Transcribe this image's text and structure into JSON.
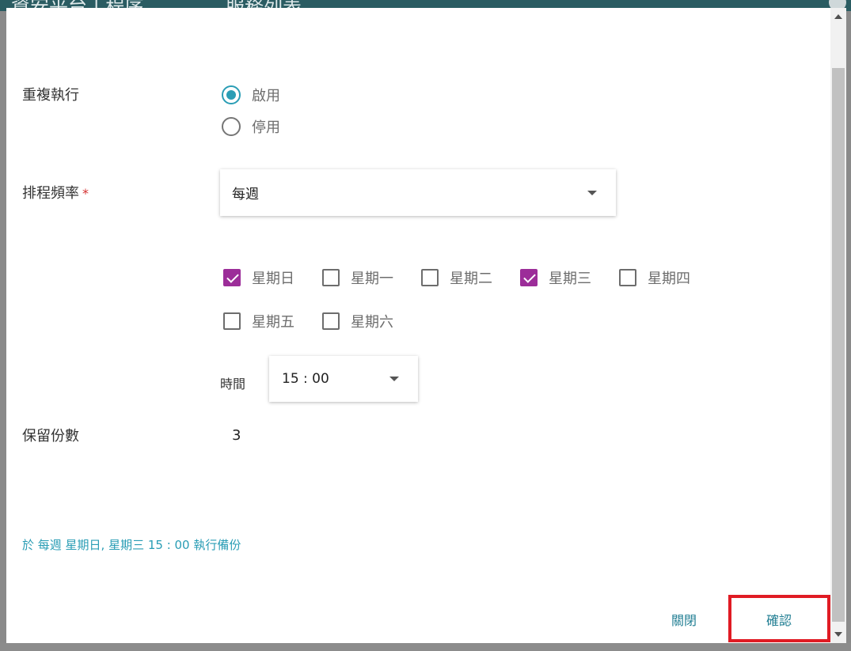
{
  "background": {
    "header_left": "資安平台 | 程序",
    "header_right": "服務列表"
  },
  "dialog": {
    "repeat": {
      "label": "重複執行",
      "options": [
        {
          "label": "啟用",
          "checked": true
        },
        {
          "label": "停用",
          "checked": false
        }
      ]
    },
    "frequency": {
      "label": "排程頻率",
      "required_mark": "*",
      "value": "每週"
    },
    "weekdays": [
      {
        "label": "星期日",
        "checked": true
      },
      {
        "label": "星期一",
        "checked": false
      },
      {
        "label": "星期二",
        "checked": false
      },
      {
        "label": "星期三",
        "checked": true
      },
      {
        "label": "星期四",
        "checked": false
      },
      {
        "label": "星期五",
        "checked": false
      },
      {
        "label": "星期六",
        "checked": false
      }
    ],
    "time": {
      "label": "時間",
      "value": "15 : 00"
    },
    "retain": {
      "label": "保留份數",
      "value": "3"
    },
    "summary": "於 每週 星期日, 星期三 15 : 00 執行備份",
    "buttons": {
      "close": "關閉",
      "confirm": "確認"
    }
  },
  "colors": {
    "accent": "#2a9db5",
    "checkbox_checked": "#9c2d99",
    "required": "#d32f2f",
    "highlight": "#e01b24"
  },
  "icons": {
    "dropdown": "caret-down-icon",
    "scroll_up": "scroll-up-arrow-icon",
    "scroll_down": "scroll-down-arrow-icon"
  }
}
